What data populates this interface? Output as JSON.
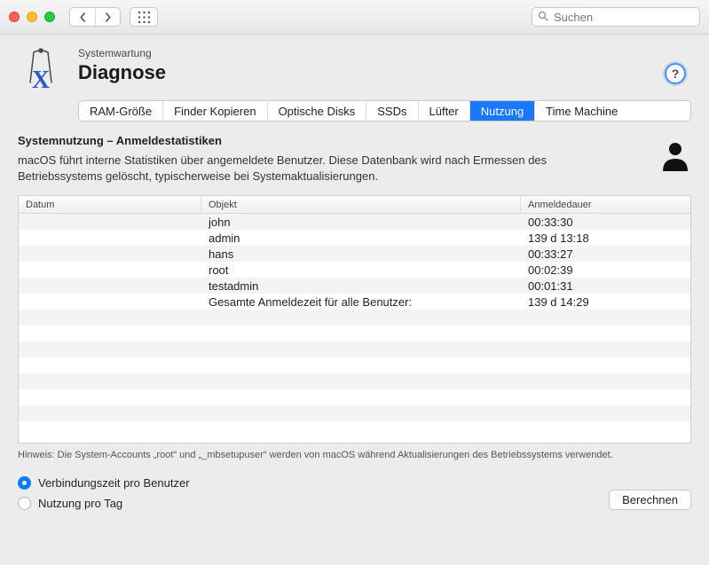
{
  "search": {
    "placeholder": "Suchen"
  },
  "breadcrumb": "Systemwartung",
  "page_title": "Diagnose",
  "help_label": "?",
  "tabs": [
    {
      "label": "RAM-Größe",
      "active": false
    },
    {
      "label": "Finder Kopieren",
      "active": false
    },
    {
      "label": "Optische Disks",
      "active": false
    },
    {
      "label": "SSDs",
      "active": false
    },
    {
      "label": "Lüfter",
      "active": false
    },
    {
      "label": "Nutzung",
      "active": true
    },
    {
      "label": "Time Machine",
      "active": false
    }
  ],
  "section": {
    "title": "Systemnutzung – Anmeldestatistiken",
    "desc": "macOS führt interne Statistiken über angemeldete Benutzer. Diese Datenbank wird nach Ermessen des Betriebssystems gelöscht, typischerweise bei Systemaktualisierungen."
  },
  "columns": {
    "0": "Datum",
    "1": "Objekt",
    "2": "Anmeldedauer"
  },
  "rows": [
    {
      "date": "",
      "object": "john",
      "dur": "00:33:30"
    },
    {
      "date": "",
      "object": "admin",
      "dur": "139 d 13:18"
    },
    {
      "date": "",
      "object": "hans",
      "dur": "00:33:27"
    },
    {
      "date": "",
      "object": "root",
      "dur": "00:02:39"
    },
    {
      "date": "",
      "object": "testadmin",
      "dur": "00:01:31"
    },
    {
      "date": "",
      "object": "Gesamte Anmeldezeit für alle Benutzer:",
      "dur": "139 d 14:29"
    }
  ],
  "blank_rows": 8,
  "note": "Hinweis: Die System-Accounts „root“ und „_mbsetupuser“ werden von macOS während Aktualisierungen des Betriebssystems verwendet.",
  "radios": {
    "0": {
      "label": "Verbindungszeit pro Benutzer",
      "selected": true
    },
    "1": {
      "label": "Nutzung pro Tag",
      "selected": false
    }
  },
  "calc_button": "Berechnen"
}
